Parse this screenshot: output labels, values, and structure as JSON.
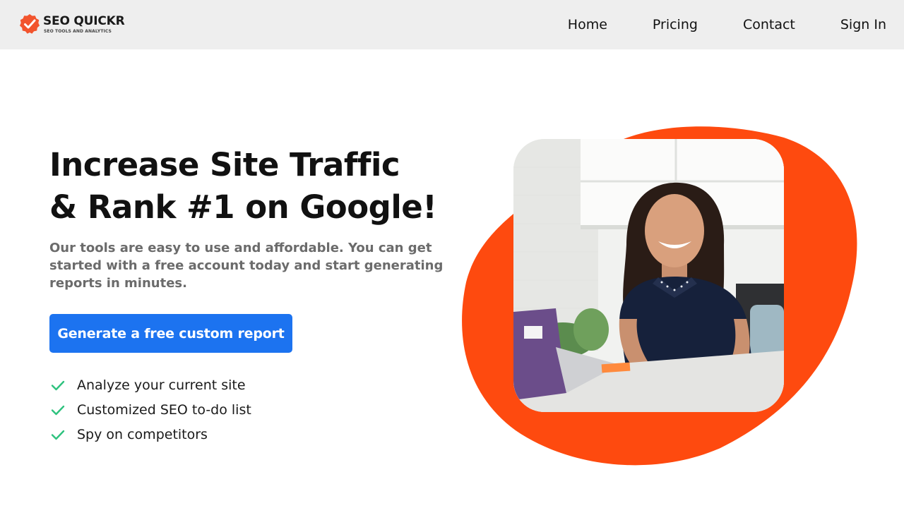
{
  "brand": {
    "name": "SEO QUICKR",
    "tagline": "SEO TOOLS AND ANALYTICS",
    "badge_color": "#f2542d",
    "logo_icon": "check-badge-icon"
  },
  "nav": {
    "items": [
      {
        "label": "Home"
      },
      {
        "label": "Pricing"
      },
      {
        "label": "Contact"
      },
      {
        "label": "Sign In"
      }
    ]
  },
  "hero": {
    "title_line1": "Increase Site Traffic",
    "title_line2": "& Rank #1 on Google!",
    "subtitle": "Our tools are easy to use and affordable. You can get started with a free account today and start generating reports in minutes.",
    "cta_label": "Generate a free custom report",
    "features": [
      {
        "label": "Analyze your current site",
        "icon": "check-icon"
      },
      {
        "label": "Customized SEO to-do list",
        "icon": "check-icon"
      },
      {
        "label": "Spy on competitors",
        "icon": "check-icon"
      }
    ]
  },
  "colors": {
    "accent": "#1c73f0",
    "blob": "#fe4a0f",
    "check": "#2ec27e",
    "topbar": "#eeeeee"
  }
}
